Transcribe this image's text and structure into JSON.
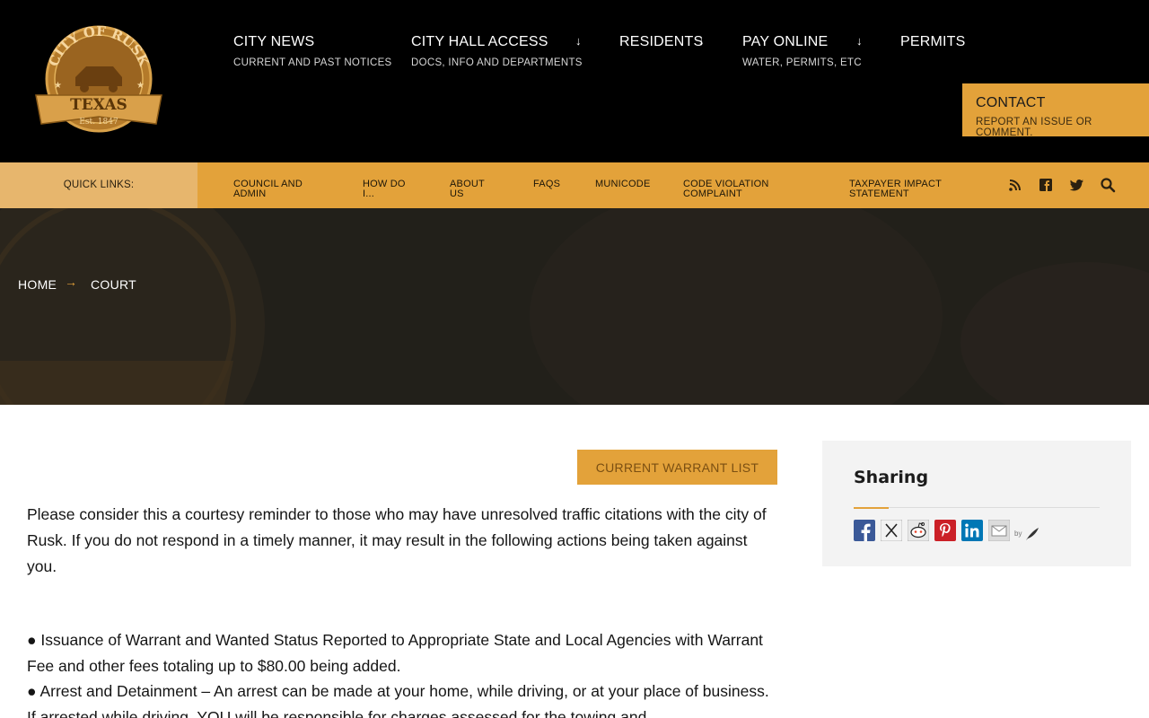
{
  "logo": {
    "alt": "City of Rusk Texas seal",
    "top_text": "CITY OF RUSK",
    "mid_text": "TEXAS",
    "est_text": "Est. 1847"
  },
  "nav": {
    "items": [
      {
        "title": "CITY NEWS",
        "sub": "CURRENT AND PAST NOTICES"
      },
      {
        "title": "CITY HALL ACCESS",
        "sub": "DOCS, INFO AND DEPARTMENTS",
        "arrow": "↓"
      },
      {
        "title": "RESIDENTS",
        "sub": "",
        "arrow": "↓"
      },
      {
        "title": "PAY ONLINE",
        "sub": "WATER, PERMITS, ETC",
        "arrow": "↓"
      },
      {
        "title": "PERMITS",
        "sub": ""
      }
    ],
    "contact": {
      "title": "CONTACT",
      "sub": "REPORT AN ISSUE OR COMMENT."
    }
  },
  "quick_links": {
    "label": "QUICK LINKS:",
    "items": [
      {
        "line1": "COUNCIL AND",
        "line2": "ADMIN"
      },
      {
        "line1": "HOW DO",
        "line2": "I..."
      },
      {
        "line1": "ABOUT",
        "line2": "US"
      },
      {
        "line1": "FAQS",
        "line2": ""
      },
      {
        "line1": "MUNICODE",
        "line2": ""
      },
      {
        "line1": "CODE VIOLATION",
        "line2": "COMPLAINT"
      },
      {
        "line1": "TAXPAYER IMPACT",
        "line2": "STATEMENT"
      }
    ],
    "icons": [
      "rss-icon",
      "facebook-icon",
      "twitter-icon",
      "search-icon"
    ]
  },
  "breadcrumb": {
    "home": "HOME",
    "separator": "→",
    "current": "COURT"
  },
  "main": {
    "warrant_button": "CURRENT WARRANT LIST",
    "paragraph1": "Please consider this a courtesy reminder to those who may have unresolved traffic citations with the city of Rusk. If you do not respond in a timely manner, it may result in the following actions being taken against you.",
    "bullet1": "● Issuance of Warrant and Wanted Status Reported to Appropriate State and Local Agencies with Warrant Fee and other fees totaling up to $80.00 being added.",
    "bullet2": "● Arrest and Detainment – An arrest can be made at your home, while driving, or at your place of business. If arrested while driving, YOU will be responsible for charges assessed for the towing and"
  },
  "sidebar": {
    "title": "Sharing",
    "share_icons": [
      "facebook-share-icon",
      "x-share-icon",
      "reddit-share-icon",
      "pinterest-share-icon",
      "linkedin-share-icon",
      "email-share-icon"
    ],
    "by_label": "by"
  },
  "colors": {
    "accent": "#e3a23a",
    "header_bg": "#000000",
    "hero_bg": "#2a2722",
    "sidebar_bg": "#f3f3f3"
  }
}
